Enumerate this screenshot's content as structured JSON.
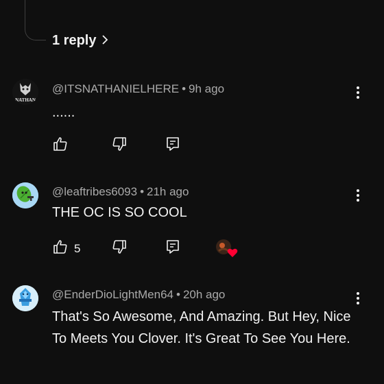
{
  "replies": {
    "label": "1 reply"
  },
  "comments": [
    {
      "author": "@ITSNATHANIELHERE",
      "time": "9h ago",
      "text": "......",
      "avatar_text": "NATHAN",
      "likes": ""
    },
    {
      "author": "@leaftribes6093",
      "time": "21h ago",
      "text": "THE OC IS SO COOL",
      "likes": "5"
    },
    {
      "author": "@EnderDioLightMen64",
      "time": "20h ago",
      "text": "That's So Awesome, And Amazing. But Hey, Nice To Meets You Clover. It's Great To See You Here."
    }
  ],
  "separator": "•",
  "colors": {
    "background": "#0f0f0f",
    "text": "#f1f1f1",
    "meta": "#aaaaaa",
    "heart": "#ff0033"
  },
  "icons": [
    "chevron-right-icon",
    "like-icon",
    "dislike-icon",
    "reply-icon",
    "more-vert-icon",
    "creator-heart-icon"
  ]
}
